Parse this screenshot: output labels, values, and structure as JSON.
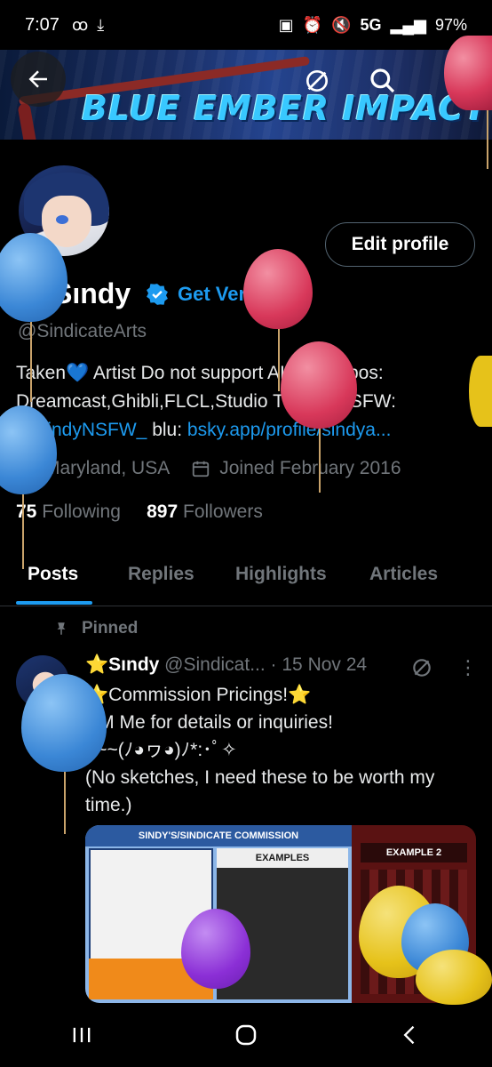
{
  "status_bar": {
    "time": "7:07",
    "left_icons": [
      "voicemail-icon",
      "download-icon"
    ],
    "network": "5G",
    "battery": "97%"
  },
  "banner": {
    "title": "BLUE EMBER IMPACT"
  },
  "header": {
    "back": "back-arrow-icon",
    "grok": "grok-icon",
    "search": "search-icon",
    "more": "more-vertical-icon"
  },
  "profile": {
    "edit_button": "Edit profile",
    "name": "Sındy",
    "get_verified": "Get Verified",
    "handle": "@SindicateArts",
    "bio_line1": "Taken💙  Artist Do not support AI Art. Inspos:",
    "bio_line2": "Dreamcast,Ghibli,FLCL,Studio Trigger NSFW:",
    "bio_mention": "@SindyNSFW_",
    "bio_blu": " blu: ",
    "bio_link": "bsky.app/profile/sindya...",
    "location": "Maryland, USA",
    "joined": "Joined February 2016",
    "following_count": "75",
    "following_label": "Following",
    "followers_count": "897",
    "followers_label": "Followers"
  },
  "tabs": [
    "Posts",
    "Replies",
    "Highlights",
    "Articles"
  ],
  "post": {
    "pinned_label": "Pinned",
    "display_name": "⭐Sındy",
    "handle": "@Sindicat...",
    "date": "· 15 Nov 24",
    "text": "⭐Commission Pricings!⭐\nDM Me for details or inquiries!\n        ~~~(ﾉ◕ヮ◕)ﾉ*:･ﾟ✧\n(No sketches, I need these to be worth my time.)",
    "media_left_header": "SINDY'S/SINDICATE COMMISSION",
    "media_examples": "EXAMPLES",
    "media_example2": "EXAMPLE 2"
  },
  "navbar": [
    "recents-icon",
    "home-icon",
    "back-icon"
  ]
}
